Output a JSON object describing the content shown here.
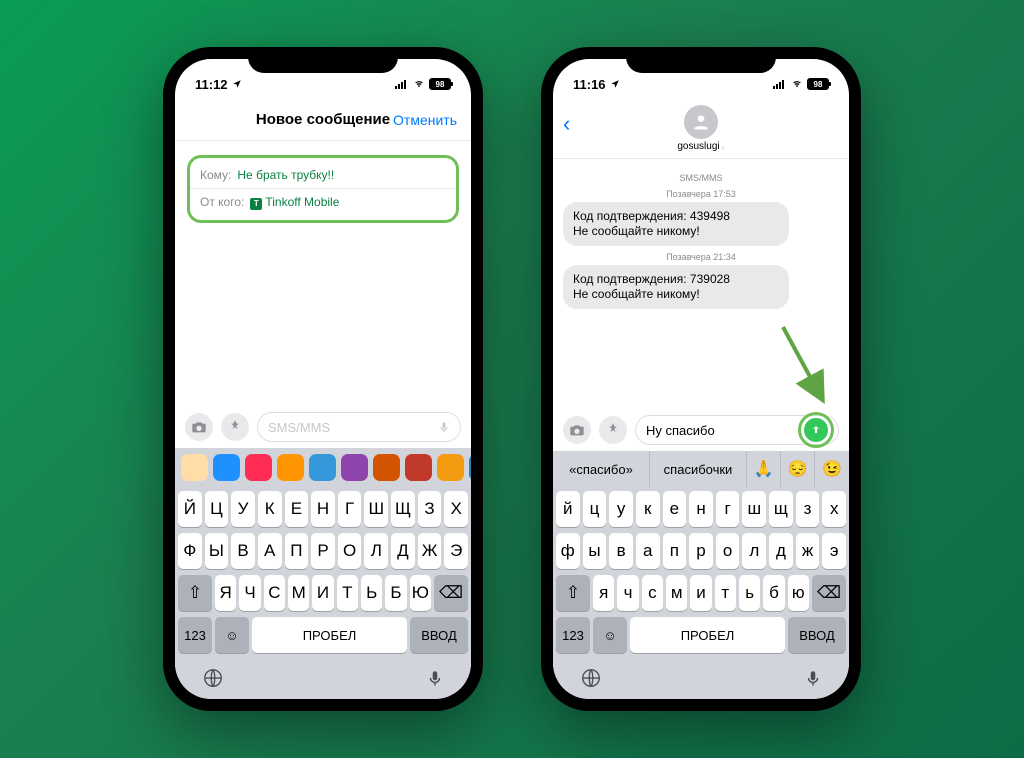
{
  "phoneA": {
    "time": "11:12",
    "battery": "98",
    "title": "Новое сообщение",
    "cancel": "Отменить",
    "to_label": "Кому:",
    "to_value": "Не брать трубку!!",
    "from_label": "От кого:",
    "from_value": "Tinkoff Mobile",
    "placeholder": "SMS/MMS",
    "keyboard": {
      "row1": [
        "Й",
        "Ц",
        "У",
        "К",
        "Е",
        "Н",
        "Г",
        "Ш",
        "Щ",
        "З",
        "Х"
      ],
      "row2": [
        "Ф",
        "Ы",
        "В",
        "А",
        "П",
        "Р",
        "О",
        "Л",
        "Д",
        "Ж",
        "Э"
      ],
      "row3": [
        "Я",
        "Ч",
        "С",
        "М",
        "И",
        "Т",
        "Ь",
        "Б",
        "Ю"
      ],
      "shift": "⇧",
      "del": "⌫",
      "numkey": "123",
      "space": "Пробел",
      "enter": "Ввод"
    }
  },
  "phoneB": {
    "time": "11:16",
    "battery": "98",
    "contact": "gosuslugi",
    "thread": {
      "header": "SMS/MMS",
      "ts1": "Позавчера 17:53",
      "msg1": "Код подтверждения: 439498\nНе сообщайте никому!",
      "ts2": "Позавчера 21:34",
      "msg2": "Код подтверждения: 739028\nНе сообщайте никому!"
    },
    "draft": "Ну спасибо",
    "suggestions": [
      "«спасибо»",
      "спасибочки"
    ],
    "sugg_emojis": [
      "🙏",
      "😔",
      "😉"
    ],
    "keyboard": {
      "row1": [
        "й",
        "ц",
        "у",
        "к",
        "е",
        "н",
        "г",
        "ш",
        "щ",
        "з",
        "х"
      ],
      "row2": [
        "ф",
        "ы",
        "в",
        "а",
        "п",
        "р",
        "о",
        "л",
        "д",
        "ж",
        "э"
      ],
      "row3": [
        "я",
        "ч",
        "с",
        "м",
        "и",
        "т",
        "ь",
        "б",
        "ю"
      ],
      "shift": "⇧",
      "del": "⌫",
      "numkey": "123",
      "space": "Пробел",
      "enter": "Ввод"
    }
  },
  "app_colors": [
    "#ffdca8",
    "#1e90ff",
    "#ff2d55",
    "#ff9500",
    "#3498db",
    "#8e44ad",
    "#d35400",
    "#c0392b",
    "#f39c12",
    "#2980b9"
  ]
}
